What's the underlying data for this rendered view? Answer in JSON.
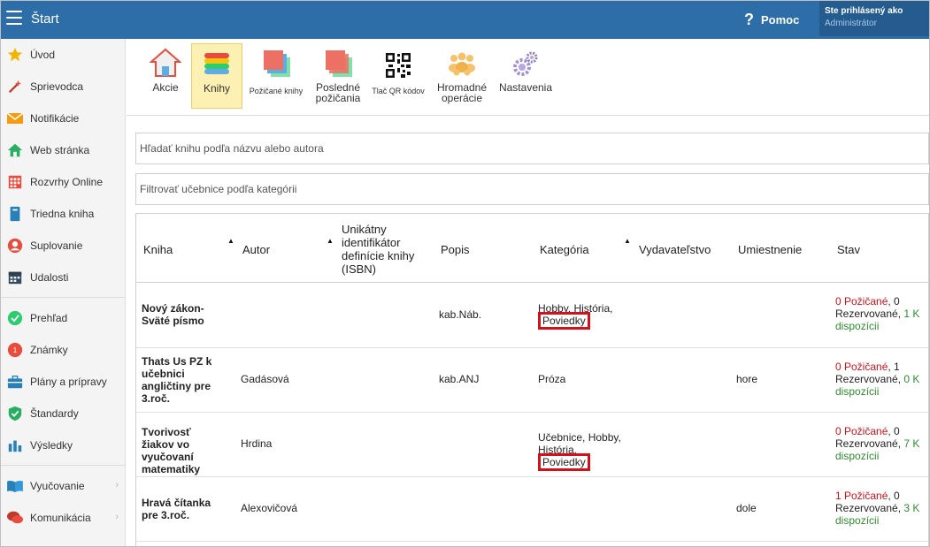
{
  "header": {
    "title": "Štart",
    "help_label": "Pomoc",
    "user_line1": "Ste prihlásený ako",
    "user_line2": "Administrátor"
  },
  "sidebar": {
    "items": [
      {
        "label": "Úvod",
        "icon": "star-icon"
      },
      {
        "label": "Sprievodca",
        "icon": "magic-wand-icon"
      },
      {
        "label": "Notifikácie",
        "icon": "envelope-icon"
      },
      {
        "label": "Web stránka",
        "icon": "house-icon"
      },
      {
        "label": "Rozvrhy Online",
        "icon": "calendar-grid-icon"
      },
      {
        "label": "Triedna kniha",
        "icon": "book-icon"
      },
      {
        "label": "Suplovanie",
        "icon": "person-icon"
      },
      {
        "label": "Udalosti",
        "icon": "calendar-icon"
      },
      {
        "label": "Prehľad",
        "icon": "check-circle-icon"
      },
      {
        "label": "Známky",
        "icon": "grade-icon"
      },
      {
        "label": "Plány a prípravy",
        "icon": "briefcase-icon"
      },
      {
        "label": "Štandardy",
        "icon": "shield-check-icon"
      },
      {
        "label": "Výsledky",
        "icon": "bar-chart-icon"
      },
      {
        "label": "Vyučovanie",
        "icon": "open-book-icon"
      },
      {
        "label": "Komunikácia",
        "icon": "chat-icon"
      }
    ]
  },
  "toolbar": {
    "items": [
      {
        "label": "Akcie",
        "icon": "house-icon"
      },
      {
        "label": "Knihy",
        "icon": "book-stack-icon"
      },
      {
        "label": "Požičané knihy",
        "icon": "borrowed-books-icon"
      },
      {
        "label": "Posledné požičania",
        "icon": "recent-loans-icon"
      },
      {
        "label": "Tlač QR kódov",
        "icon": "qr-code-icon"
      },
      {
        "label": "Hromadné operácie",
        "icon": "group-icon"
      },
      {
        "label": "Nastavenia",
        "icon": "gears-icon"
      }
    ]
  },
  "search": {
    "placeholder": "Hľadať knihu podľa názvu alebo autora",
    "filter_placeholder": "Filtrovať učebnice podľa kategórii"
  },
  "table": {
    "headers": {
      "kniha": "Kniha",
      "autor": "Autor",
      "isbn": "Unikátny identifikátor definície knihy (ISBN)",
      "popis": "Popis",
      "kategoria": "Kategória",
      "vydavatelstvo": "Vydavateľstvo",
      "umiestnenie": "Umiestnenie",
      "stav": "Stav"
    },
    "rows": [
      {
        "kniha": "Nový zákon-Sväté písmo",
        "autor": "",
        "popis": "kab.Náb.",
        "kategoria_text": "Hobby, História,",
        "kategoria_highlight": "Poviedky",
        "umiestnenie": "",
        "stav_borrowed": "0 Požičané",
        "stav_reserved_count": "0",
        "stav_reserved_label": "Rezervované",
        "stav_available": "1 K dispozícii"
      },
      {
        "kniha": "Thats Us PZ k učebnici angličtiny pre 3.roč.",
        "autor": "Gadásová",
        "popis": "kab.ANJ",
        "kategoria_text": "Próza",
        "kategoria_highlight": "",
        "umiestnenie": "hore",
        "stav_borrowed": "0 Požičané",
        "stav_reserved_count": "1",
        "stav_reserved_label": "Rezervované",
        "stav_available": "0 K dispozícii"
      },
      {
        "kniha": "Tvorivosť žiakov vo vyučovaní matematiky",
        "autor": "Hrdina",
        "popis": "",
        "kategoria_text": "Učebnice, Hobby, História,",
        "kategoria_highlight": "Poviedky",
        "umiestnenie": "",
        "stav_borrowed": "0 Požičané",
        "stav_reserved_count": "0",
        "stav_reserved_label": "Rezervované",
        "stav_available": "7 K dispozícii"
      },
      {
        "kniha": "Hravá čítanka pre 3.roč.",
        "autor": "Alexovičová",
        "popis": "",
        "kategoria_text": "",
        "kategoria_highlight": "",
        "umiestnenie": "dole",
        "stav_borrowed": "1 Požičané",
        "stav_reserved_count": "0",
        "stav_reserved_label": "Rezervované",
        "stav_available": "3 K dispozícii"
      }
    ]
  }
}
